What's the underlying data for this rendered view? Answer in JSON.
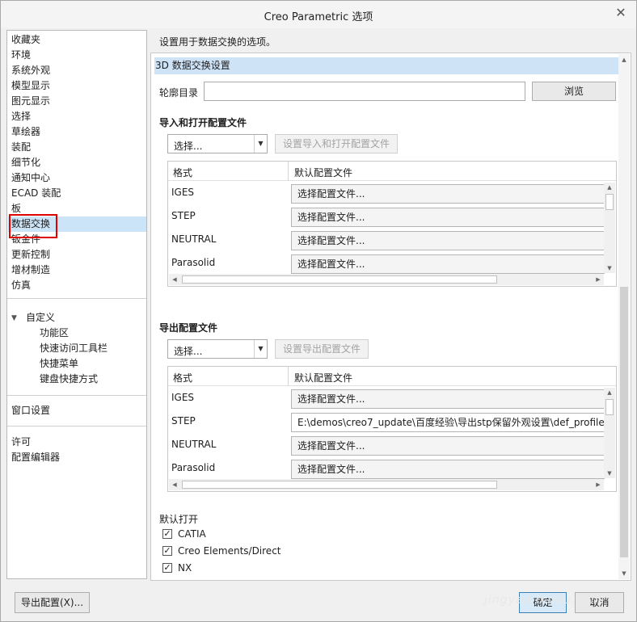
{
  "window": {
    "title": "Creo Parametric 选项",
    "close_glyph": "✕"
  },
  "sidebar": {
    "items": [
      {
        "label": "收藏夹"
      },
      {
        "label": "环境"
      },
      {
        "label": "系统外观"
      },
      {
        "label": "模型显示"
      },
      {
        "label": "图元显示"
      },
      {
        "label": "选择"
      },
      {
        "label": "草绘器"
      },
      {
        "label": "装配"
      },
      {
        "label": "细节化"
      },
      {
        "label": "通知中心"
      },
      {
        "label": "ECAD 装配"
      },
      {
        "label": "板"
      },
      {
        "label": "数据交换",
        "selected": true
      },
      {
        "label": "钣金件"
      },
      {
        "label": "更新控制"
      },
      {
        "label": "增材制造"
      },
      {
        "label": "仿真"
      }
    ],
    "customize": {
      "label": "自定义",
      "children": [
        "功能区",
        "快速访问工具栏",
        "快捷菜单",
        "键盘快捷方式"
      ]
    },
    "window_settings": "窗口设置",
    "license": "许可",
    "config_editor": "配置编辑器"
  },
  "main": {
    "description": "设置用于数据交换的选项。",
    "section_title": "3D 数据交换设置",
    "profile_dir_label": "轮廓目录",
    "profile_dir_value": "",
    "browse_button": "浏览",
    "import_section": {
      "title": "导入和打开配置文件",
      "select_value": "选择...",
      "set_button": "设置导入和打开配置文件",
      "col_format": "格式",
      "col_profile": "默认配置文件",
      "rows": [
        {
          "format": "IGES",
          "profile": "选择配置文件..."
        },
        {
          "format": "STEP",
          "profile": "选择配置文件..."
        },
        {
          "format": "NEUTRAL",
          "profile": "选择配置文件..."
        },
        {
          "format": "Parasolid",
          "profile": "选择配置文件..."
        }
      ]
    },
    "export_section": {
      "title": "导出配置文件",
      "select_value": "选择...",
      "set_button": "设置导出配置文件",
      "col_format": "格式",
      "col_profile": "默认配置文件",
      "rows": [
        {
          "format": "IGES",
          "profile": "选择配置文件..."
        },
        {
          "format": "STEP",
          "profile": "E:\\demos\\creo7_update\\百度经验\\导出stp保留外观设置\\def_profile"
        },
        {
          "format": "NEUTRAL",
          "profile": "选择配置文件..."
        },
        {
          "format": "Parasolid",
          "profile": "选择配置文件..."
        }
      ]
    },
    "default_open": {
      "title": "默认打开",
      "options": [
        {
          "label": "CATIA",
          "checked": true
        },
        {
          "label": "Creo Elements/Direct",
          "checked": true
        },
        {
          "label": "NX",
          "checked": true
        }
      ]
    }
  },
  "footer": {
    "export_config_button": "导出配置(X)...",
    "ok_button": "确定",
    "cancel_button": "取消"
  },
  "watermark": "jingyan.baidu.com",
  "icons": {
    "checkmark": "✓",
    "dropdown": "▼",
    "expand_triangle": "▼",
    "arrow_up": "▲",
    "arrow_down": "▼",
    "arrow_left": "◀",
    "arrow_right": "▶"
  }
}
